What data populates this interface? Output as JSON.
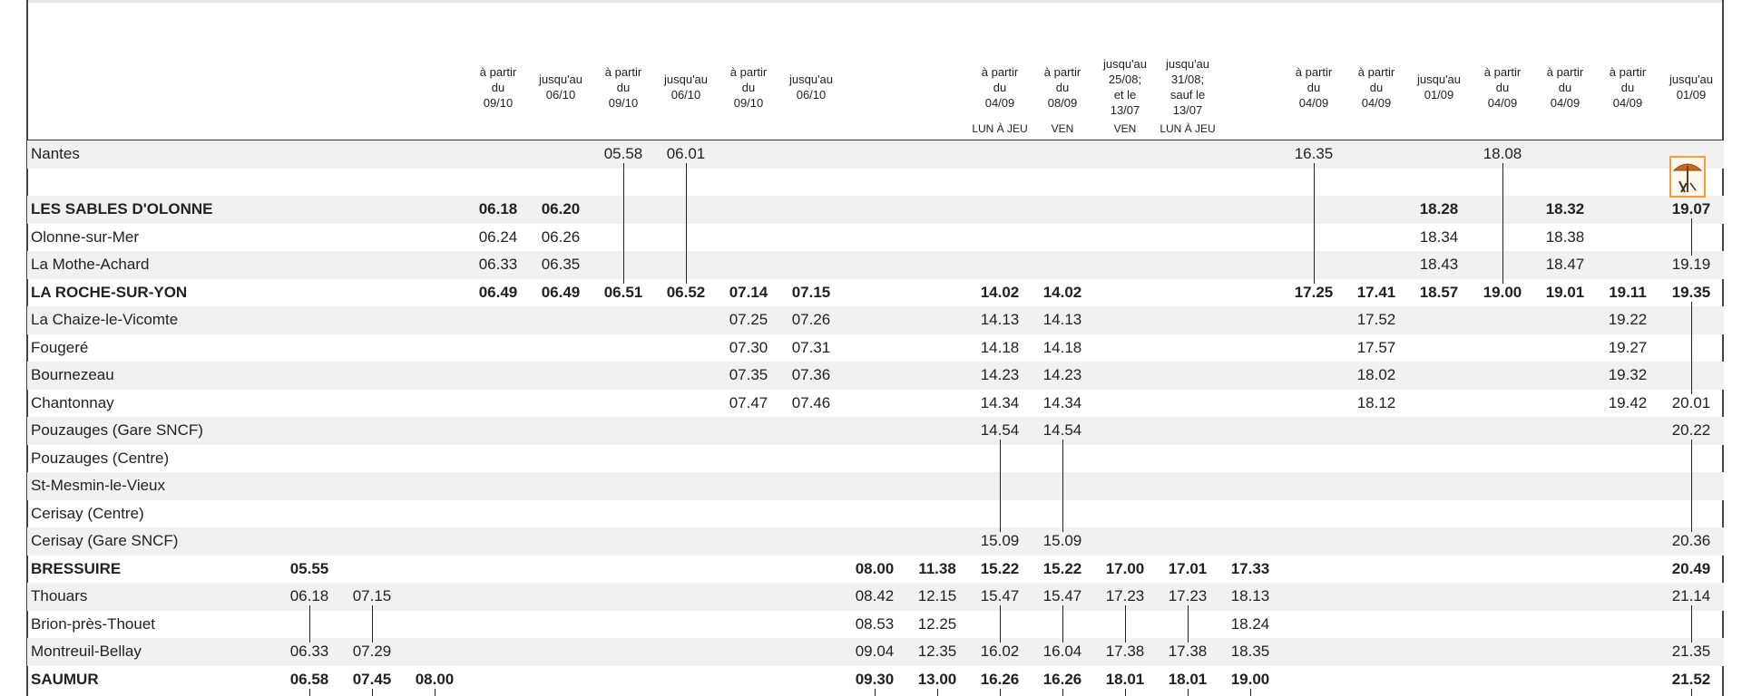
{
  "columns": [
    {
      "id": "c1",
      "note": "",
      "day": ""
    },
    {
      "id": "c2",
      "note": "",
      "day": ""
    },
    {
      "id": "c3",
      "note": "",
      "day": ""
    },
    {
      "id": "c4",
      "note": "à partir\ndu\n09/10",
      "day": ""
    },
    {
      "id": "c5",
      "note": "jusqu'au\n06/10",
      "day": ""
    },
    {
      "id": "c6",
      "note": "à partir\ndu\n09/10",
      "day": ""
    },
    {
      "id": "c7",
      "note": "jusqu'au\n06/10",
      "day": ""
    },
    {
      "id": "c8",
      "note": "à partir\ndu\n09/10",
      "day": ""
    },
    {
      "id": "c9",
      "note": "jusqu'au\n06/10",
      "day": ""
    },
    {
      "id": "c10",
      "note": "",
      "day": ""
    },
    {
      "id": "c11",
      "note": "",
      "day": ""
    },
    {
      "id": "c12",
      "note": "à partir\ndu\n04/09",
      "day": "LUN À JEU"
    },
    {
      "id": "c13",
      "note": "à partir\ndu\n08/09",
      "day": "VEN"
    },
    {
      "id": "c14",
      "note": "jusqu'au\n25/08;\net le\n13/07",
      "day": "VEN"
    },
    {
      "id": "c15",
      "note": "jusqu'au\n31/08;\nsauf le\n13/07",
      "day": "LUN À JEU"
    },
    {
      "id": "c16",
      "note": "",
      "day": ""
    },
    {
      "id": "c17",
      "note": "à partir\ndu\n04/09",
      "day": ""
    },
    {
      "id": "c18",
      "note": "à partir\ndu\n04/09",
      "day": ""
    },
    {
      "id": "c19",
      "note": "jusqu'au\n01/09",
      "day": ""
    },
    {
      "id": "c20",
      "note": "à partir\ndu\n04/09",
      "day": ""
    },
    {
      "id": "c21",
      "note": "à partir\ndu\n04/09",
      "day": ""
    },
    {
      "id": "c22",
      "note": "à partir\ndu\n04/09",
      "day": ""
    },
    {
      "id": "c23",
      "note": "jusqu'au\n01/09",
      "day": ""
    }
  ],
  "stations": [
    {
      "name": "Nantes",
      "bold": false,
      "times": {
        "c6": "05.58",
        "c7": "06.01",
        "c17": "16.35",
        "c20": "18.08"
      }
    },
    {
      "name": "",
      "bold": false,
      "times": {}
    },
    {
      "name": "LES SABLES D'OLONNE",
      "bold": true,
      "times": {
        "c4": "06.18",
        "c5": "06.20",
        "c19": "18.28",
        "c21": "18.32",
        "c23": "19.07"
      }
    },
    {
      "name": "Olonne-sur-Mer",
      "bold": false,
      "times": {
        "c4": "06.24",
        "c5": "06.26",
        "c19": "18.34",
        "c21": "18.38"
      }
    },
    {
      "name": "La Mothe-Achard",
      "bold": false,
      "times": {
        "c4": "06.33",
        "c5": "06.35",
        "c19": "18.43",
        "c21": "18.47",
        "c23": "19.19"
      }
    },
    {
      "name": "LA ROCHE-SUR-YON",
      "bold": true,
      "times": {
        "c4": "06.49",
        "c5": "06.49",
        "c6": "06.51",
        "c7": "06.52",
        "c8": "07.14",
        "c9": "07.15",
        "c12": "14.02",
        "c13": "14.02",
        "c17": "17.25",
        "c18": "17.41",
        "c19": "18.57",
        "c20": "19.00",
        "c21": "19.01",
        "c22": "19.11",
        "c23": "19.35"
      }
    },
    {
      "name": "La Chaize-le-Vicomte",
      "bold": false,
      "times": {
        "c8": "07.25",
        "c9": "07.26",
        "c12": "14.13",
        "c13": "14.13",
        "c18": "17.52",
        "c22": "19.22"
      }
    },
    {
      "name": "Fougeré",
      "bold": false,
      "times": {
        "c8": "07.30",
        "c9": "07.31",
        "c12": "14.18",
        "c13": "14.18",
        "c18": "17.57",
        "c22": "19.27"
      }
    },
    {
      "name": "Bournezeau",
      "bold": false,
      "times": {
        "c8": "07.35",
        "c9": "07.36",
        "c12": "14.23",
        "c13": "14.23",
        "c18": "18.02",
        "c22": "19.32"
      }
    },
    {
      "name": "Chantonnay",
      "bold": false,
      "times": {
        "c8": "07.47",
        "c9": "07.46",
        "c12": "14.34",
        "c13": "14.34",
        "c18": "18.12",
        "c22": "19.42",
        "c23": "20.01"
      }
    },
    {
      "name": "Pouzauges (Gare SNCF)",
      "bold": false,
      "times": {
        "c12": "14.54",
        "c13": "14.54",
        "c23": "20.22"
      }
    },
    {
      "name": "Pouzauges (Centre)",
      "bold": false,
      "times": {}
    },
    {
      "name": "St-Mesmin-le-Vieux",
      "bold": false,
      "times": {}
    },
    {
      "name": "Cerisay (Centre)",
      "bold": false,
      "times": {}
    },
    {
      "name": "Cerisay (Gare SNCF)",
      "bold": false,
      "times": {
        "c12": "15.09",
        "c13": "15.09",
        "c23": "20.36"
      }
    },
    {
      "name": "BRESSUIRE",
      "bold": true,
      "times": {
        "c1": "05.55",
        "c10": "08.00",
        "c11": "11.38",
        "c12": "15.22",
        "c13": "15.22",
        "c14": "17.00",
        "c15": "17.01",
        "c16": "17.33",
        "c23": "20.49"
      }
    },
    {
      "name": "Thouars",
      "bold": false,
      "times": {
        "c1": "06.18",
        "c2": "07.15",
        "c10": "08.42",
        "c11": "12.15",
        "c12": "15.47",
        "c13": "15.47",
        "c14": "17.23",
        "c15": "17.23",
        "c16": "18.13",
        "c23": "21.14"
      }
    },
    {
      "name": "Brion-près-Thouet",
      "bold": false,
      "times": {
        "c10": "08.53",
        "c11": "12.25",
        "c16": "18.24"
      }
    },
    {
      "name": "Montreuil-Bellay",
      "bold": false,
      "times": {
        "c1": "06.33",
        "c2": "07.29",
        "c10": "09.04",
        "c11": "12.35",
        "c12": "16.02",
        "c13": "16.04",
        "c14": "17.38",
        "c15": "17.38",
        "c16": "18.35",
        "c23": "21.35"
      }
    },
    {
      "name": "SAUMUR",
      "bold": true,
      "times": {
        "c1": "06.58",
        "c2": "07.45",
        "c3": "08.00",
        "c10": "09.30",
        "c11": "13.00",
        "c12": "16.26",
        "c13": "16.26",
        "c14": "18.01",
        "c15": "18.01",
        "c16": "19.00",
        "c23": "21.52"
      }
    }
  ],
  "icon": "beach-umbrella-icon",
  "colors": {
    "stripe": "#f1f1f1",
    "rule": "#333333",
    "icon_accent": "#f0a040"
  }
}
